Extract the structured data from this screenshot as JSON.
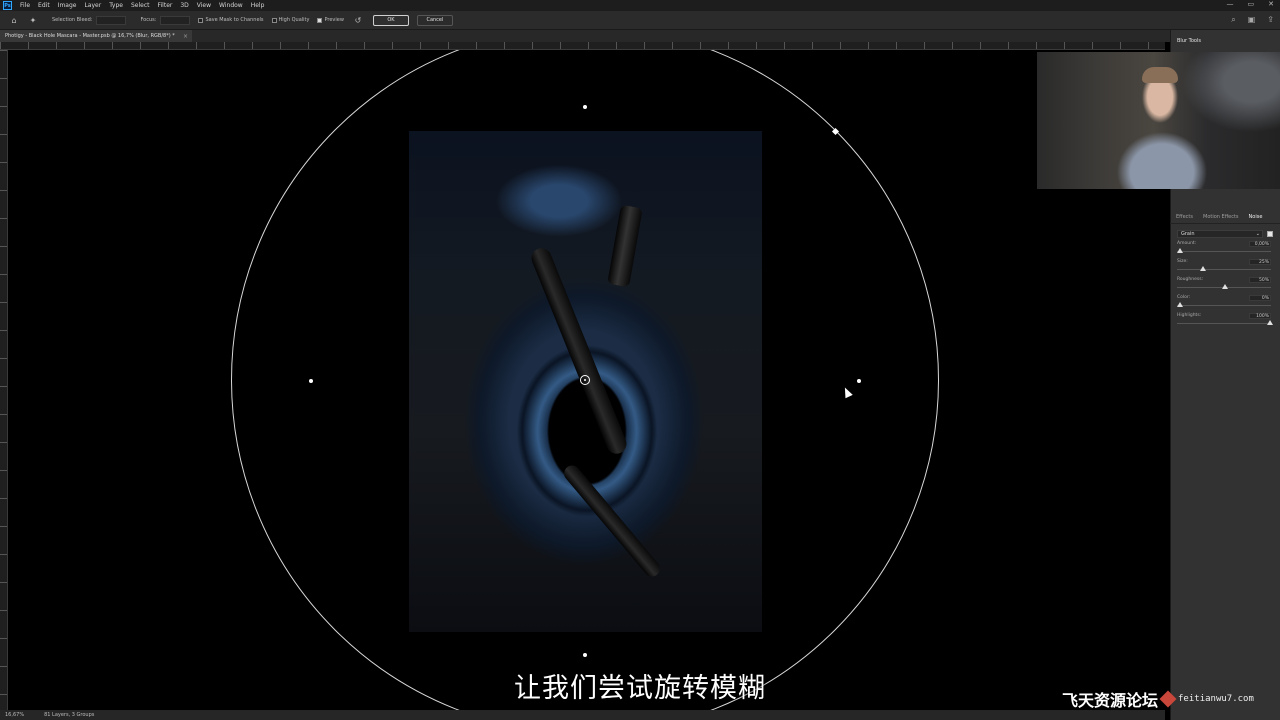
{
  "app": {
    "logo": "Ps"
  },
  "menu": [
    "File",
    "Edit",
    "Image",
    "Layer",
    "Type",
    "Select",
    "Filter",
    "3D",
    "View",
    "Window",
    "Help"
  ],
  "window_controls": [
    "—",
    "▭",
    "✕"
  ],
  "options": {
    "selection_bleed": "Selection Bleed:",
    "focus": "Focus:",
    "save_mask": "Save Mask to Channels",
    "high_quality": "High Quality",
    "preview": "Preview",
    "ok": "OK",
    "cancel": "Cancel",
    "reset_icon": "↺"
  },
  "document": {
    "tab_title": "Photigy - Black Hole Mascara - Master.psb @ 16,7% (Blur, RGB/8*) *",
    "close": "×"
  },
  "status": {
    "zoom": "16,67%",
    "info": "81 Layers, 3 Groups"
  },
  "panel": {
    "title": "Blur Tools"
  },
  "effects": {
    "tabs": [
      "Effects",
      "Motion Effects",
      "Noise"
    ],
    "active_tab": "Noise",
    "preset": "Grain",
    "sliders": [
      {
        "label": "Amount:",
        "value": "0,00%",
        "fraction": 0.0
      },
      {
        "label": "Size:",
        "value": "25%",
        "fraction": 0.25
      },
      {
        "label": "Roughness:",
        "value": "50%",
        "fraction": 0.5
      },
      {
        "label": "Color:",
        "value": "0%",
        "fraction": 0.0
      },
      {
        "label": "Highlights:",
        "value": "100%",
        "fraction": 1.0
      }
    ]
  },
  "subtitle": "让我们尝试旋转模糊",
  "watermark": {
    "text": "飞天资源论坛",
    "url": "feitianwu7.com"
  }
}
